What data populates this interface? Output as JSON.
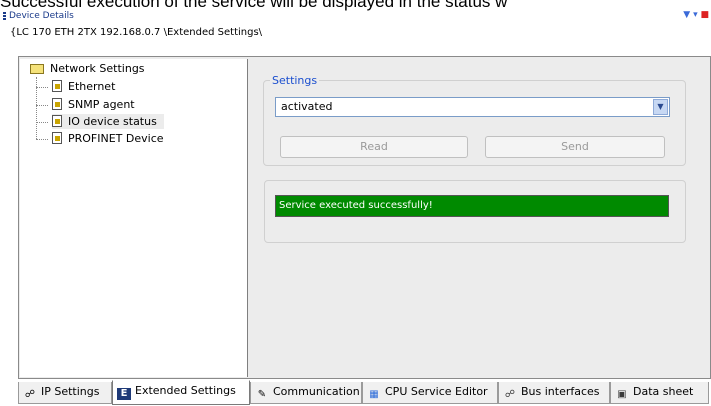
{
  "caption": "Successful execution of the service will be displayed in the status w",
  "window": {
    "title": "Device Details",
    "path": "{LC 170 ETH 2TX 192.168.0.7 \\Extended Settings\\",
    "pin_icon": "pin-icon",
    "menu_icon": "chevron-down-icon",
    "close_icon": "close-icon"
  },
  "tree": {
    "root": "Network Settings",
    "items": [
      "Ethernet",
      "SNMP agent",
      "IO device status",
      "PROFINET Device"
    ],
    "selected": "IO device status"
  },
  "settings": {
    "legend": "Settings",
    "value": "activated",
    "read_label": "Read",
    "send_label": "Send"
  },
  "status": {
    "message": "Service executed successfully!",
    "color": "#008a00"
  },
  "tabs": [
    {
      "label": "IP Settings",
      "icon": "network-icon"
    },
    {
      "label": "Extended Settings",
      "icon": "extended-settings-icon"
    },
    {
      "label": "Communication",
      "icon": "communication-icon"
    },
    {
      "label": "CPU Service Editor",
      "icon": "cpu-service-icon"
    },
    {
      "label": "Bus interfaces",
      "icon": "bus-interfaces-icon"
    },
    {
      "label": "Data sheet",
      "icon": "data-sheet-icon"
    }
  ],
  "active_tab": "Extended Settings"
}
